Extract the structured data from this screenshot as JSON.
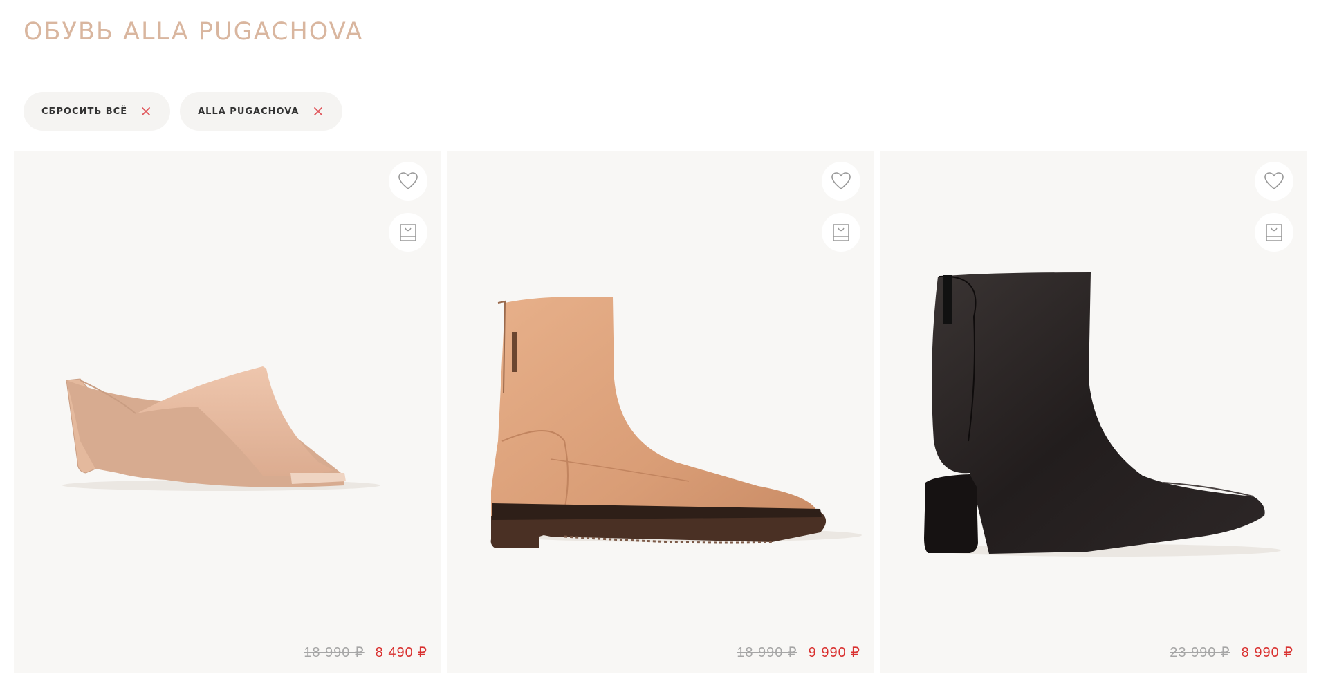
{
  "page": {
    "title": "ОБУВЬ ALLA PUGACHOVA"
  },
  "filters": [
    {
      "label": "СБРОСИТЬ ВСЁ",
      "icon": "close-icon"
    },
    {
      "label": "ALLA PUGACHOVA",
      "icon": "close-icon"
    }
  ],
  "products": [
    {
      "image": "beige-leather-mule-heel",
      "old_price": "18 990 ₽",
      "price": "8 490 ₽",
      "icons": [
        "heart-icon",
        "shopping-bag-icon"
      ]
    },
    {
      "image": "tan-leather-ankle-boot",
      "old_price": "18 990 ₽",
      "price": "9 990 ₽",
      "icons": [
        "heart-icon",
        "shopping-bag-icon"
      ]
    },
    {
      "image": "black-leather-heeled-ankle-boot",
      "old_price": "23 990 ₽",
      "price": "8 990 ₽",
      "icons": [
        "heart-icon",
        "shopping-bag-icon"
      ]
    }
  ],
  "colors": {
    "title": "#d9b69f",
    "chip_bg": "#f5f4f2",
    "close_x": "#e0555a",
    "card_bg": "#f8f7f5",
    "sale_price": "#d9302f",
    "old_price": "#a6a6a6"
  }
}
